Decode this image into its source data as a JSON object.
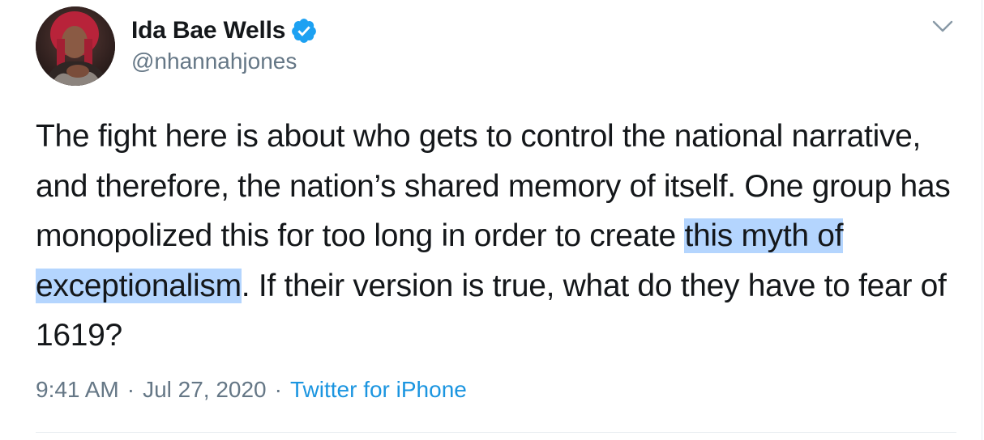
{
  "author": {
    "display_name": "Ida Bae Wells",
    "handle": "@nhannahjones",
    "verified": true
  },
  "tweet": {
    "text_before": "The fight here is about who gets to control the national narrative, and therefore, the nation’s shared memory of itself. One group has monopolized this for too long in order to create ",
    "text_highlighted": "this myth of exceptionalism",
    "text_after": ". If their version is true, what do they have to fear of 1619?"
  },
  "meta": {
    "time": "9:41 AM",
    "separator": "·",
    "date": "Jul 27, 2020",
    "source": "Twitter for iPhone"
  },
  "icons": {
    "verified": "verified-badge-icon",
    "menu": "chevron-down-icon"
  },
  "colors": {
    "text": "#14171a",
    "secondary": "#657786",
    "link": "#1b95e0",
    "verified": "#1da1f2",
    "selection": "#b4d5fe"
  }
}
